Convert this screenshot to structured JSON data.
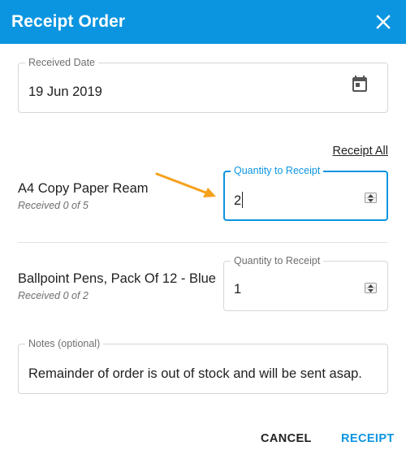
{
  "dialog": {
    "title": "Receipt Order",
    "close_icon": "close-icon"
  },
  "received_date": {
    "label": "Received Date",
    "value": "19 Jun 2019",
    "icon": "calendar-icon"
  },
  "receipt_all_label": "Receipt All",
  "items": [
    {
      "name": "A4 Copy Paper Ream",
      "received_text": "Received 0 of 5",
      "quantity_label": "Quantity to Receipt",
      "quantity_value": "2",
      "focused": true
    },
    {
      "name": "Ballpoint Pens, Pack Of 12 - Blue",
      "received_text": "Received 0 of 2",
      "quantity_label": "Quantity to Receipt",
      "quantity_value": "1",
      "focused": false
    }
  ],
  "notes": {
    "label": "Notes (optional)",
    "value": "Remainder of order is out of stock and will be sent asap."
  },
  "actions": {
    "cancel_label": "CANCEL",
    "receipt_label": "RECEIPT"
  },
  "colors": {
    "header": "#0b95e0",
    "accent": "#0b95e0",
    "annotation_arrow": "#f5a11c"
  }
}
